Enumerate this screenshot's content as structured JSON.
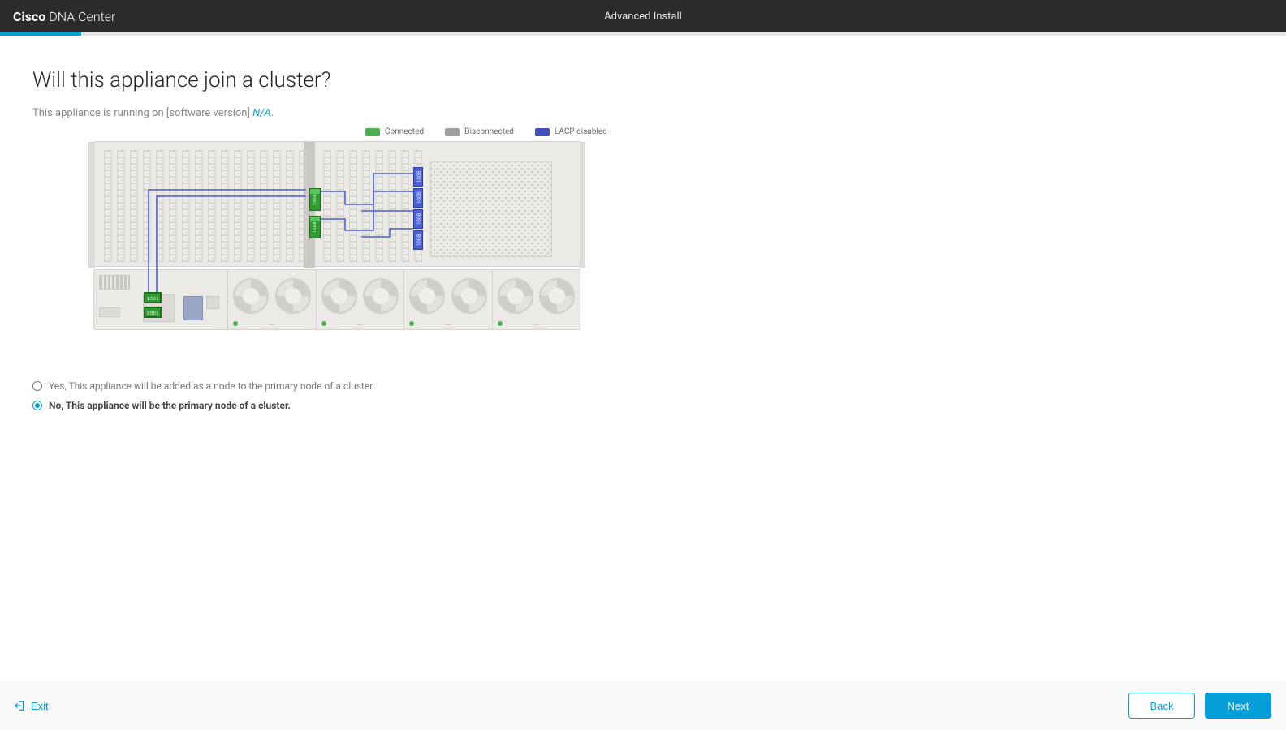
{
  "header": {
    "brand_bold": "Cisco",
    "brand_light": "DNA Center",
    "center_title": "Advanced Install"
  },
  "page": {
    "title": "Will this appliance join a cluster?",
    "subtitle_prefix": "This appliance is running on [software version] ",
    "subtitle_link": "N/A",
    "subtitle_suffix": "."
  },
  "legend": {
    "connected": "Connected",
    "disconnected": "Disconnected",
    "lacp": "LACP disabled"
  },
  "ports": {
    "green_top_label": "10GB",
    "green_bot_label": "10GB",
    "green_big_top": "10GB",
    "green_big_bot": "10GB",
    "blue_labels": [
      "10GB",
      "10GB",
      "10GB",
      "10GB"
    ]
  },
  "options": {
    "yes_label": "Yes, This appliance will be added as a node to the primary node of a cluster.",
    "no_label": "No, This appliance will be the primary node of a cluster.",
    "selected": "no"
  },
  "footer": {
    "exit": "Exit",
    "back": "Back",
    "next": "Next"
  },
  "colors": {
    "accent": "#049fd9",
    "connected": "#4caf50",
    "disconnected": "#9e9e9e",
    "lacp": "#3f51b5"
  }
}
